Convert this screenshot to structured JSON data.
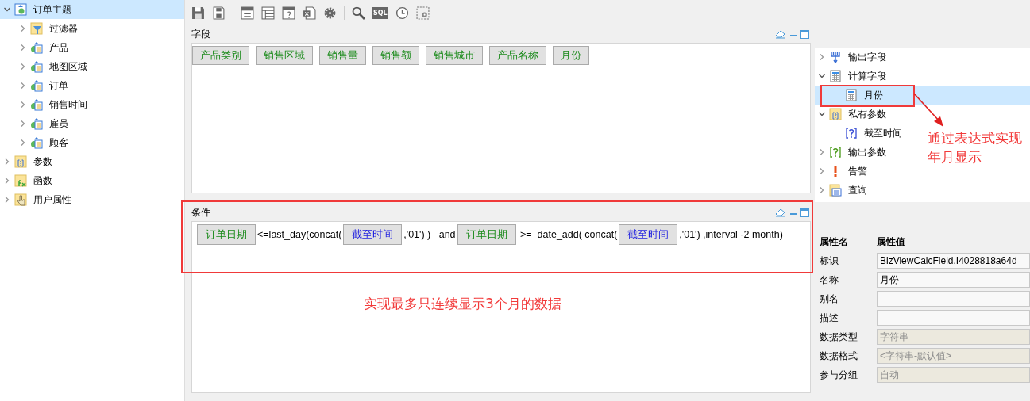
{
  "left_tree": [
    {
      "label": "订单主题",
      "kind": "topic",
      "expanded": true,
      "selected": true,
      "children": [
        {
          "label": "过滤器",
          "kind": "filter",
          "expanded": false,
          "selected": false
        },
        {
          "label": "产品",
          "kind": "table",
          "expanded": false,
          "selected": false
        },
        {
          "label": "地图区域",
          "kind": "table",
          "expanded": false,
          "selected": false
        },
        {
          "label": "订单",
          "kind": "table",
          "expanded": false,
          "selected": false
        },
        {
          "label": "销售时间",
          "kind": "table",
          "expanded": false,
          "selected": false
        },
        {
          "label": "雇员",
          "kind": "table",
          "expanded": false,
          "selected": false
        },
        {
          "label": "顾客",
          "kind": "table",
          "expanded": false,
          "selected": false
        }
      ]
    },
    {
      "label": "参数",
      "kind": "param",
      "expanded": false,
      "selected": false
    },
    {
      "label": "函数",
      "kind": "func",
      "expanded": false,
      "selected": false
    },
    {
      "label": "用户属性",
      "kind": "hand",
      "expanded": false,
      "selected": false
    }
  ],
  "toolbar": {
    "sql_label": "SQL"
  },
  "fields_panel": {
    "title": "字段",
    "fields": [
      "产品类别",
      "销售区域",
      "销售量",
      "销售额",
      "销售城市",
      "产品名称",
      "月份"
    ]
  },
  "condition_panel": {
    "title": "条件",
    "tokens": [
      {
        "kind": "field",
        "text": "订单日期"
      },
      {
        "kind": "text",
        "text": "<=last_day(concat("
      },
      {
        "kind": "param",
        "text": "截至时间"
      },
      {
        "kind": "text",
        "text": ",'01') )   and"
      },
      {
        "kind": "field",
        "text": "订单日期"
      },
      {
        "kind": "text",
        "text": " >=  date_add( concat("
      },
      {
        "kind": "param",
        "text": "截至时间"
      },
      {
        "kind": "text",
        "text": ",'01') ,interval -2 month)"
      }
    ]
  },
  "right_tree": [
    {
      "label": "输出字段",
      "kind": "output",
      "expanded": false,
      "selected": false
    },
    {
      "label": "计算字段",
      "kind": "calc",
      "expanded": true,
      "selected": false,
      "children": [
        {
          "label": "月份",
          "kind": "calc",
          "selected": true
        }
      ]
    },
    {
      "label": "私有参数",
      "kind": "param",
      "expanded": true,
      "selected": false,
      "children": [
        {
          "label": "截至时间",
          "kind": "qmark",
          "selected": false
        }
      ]
    },
    {
      "label": "输出参数",
      "kind": "qmark-green",
      "expanded": false,
      "selected": false
    },
    {
      "label": "告警",
      "kind": "alert",
      "expanded": false,
      "selected": false
    },
    {
      "label": "查询",
      "kind": "query",
      "expanded": false,
      "selected": false
    }
  ],
  "properties": {
    "name_header": "属性名",
    "value_header": "属性值",
    "rows": [
      {
        "name": "标识",
        "value": "BizViewCalcField.I4028818a64d",
        "disabled": false
      },
      {
        "name": "名称",
        "value": "月份",
        "disabled": false
      },
      {
        "name": "别名",
        "disabled": false
      },
      {
        "name": "描述",
        "disabled": false
      },
      {
        "name": "数据类型",
        "value": "字符串",
        "disabled": true
      },
      {
        "name": "数据格式",
        "value": "<字符串-默认值>",
        "disabled": true
      },
      {
        "name": "参与分组",
        "value": "自动",
        "disabled": true
      }
    ]
  },
  "annotations": {
    "right_note": "通过表达式实现年月显示",
    "condition_note": "实现最多只连续显示3个月的数据"
  }
}
